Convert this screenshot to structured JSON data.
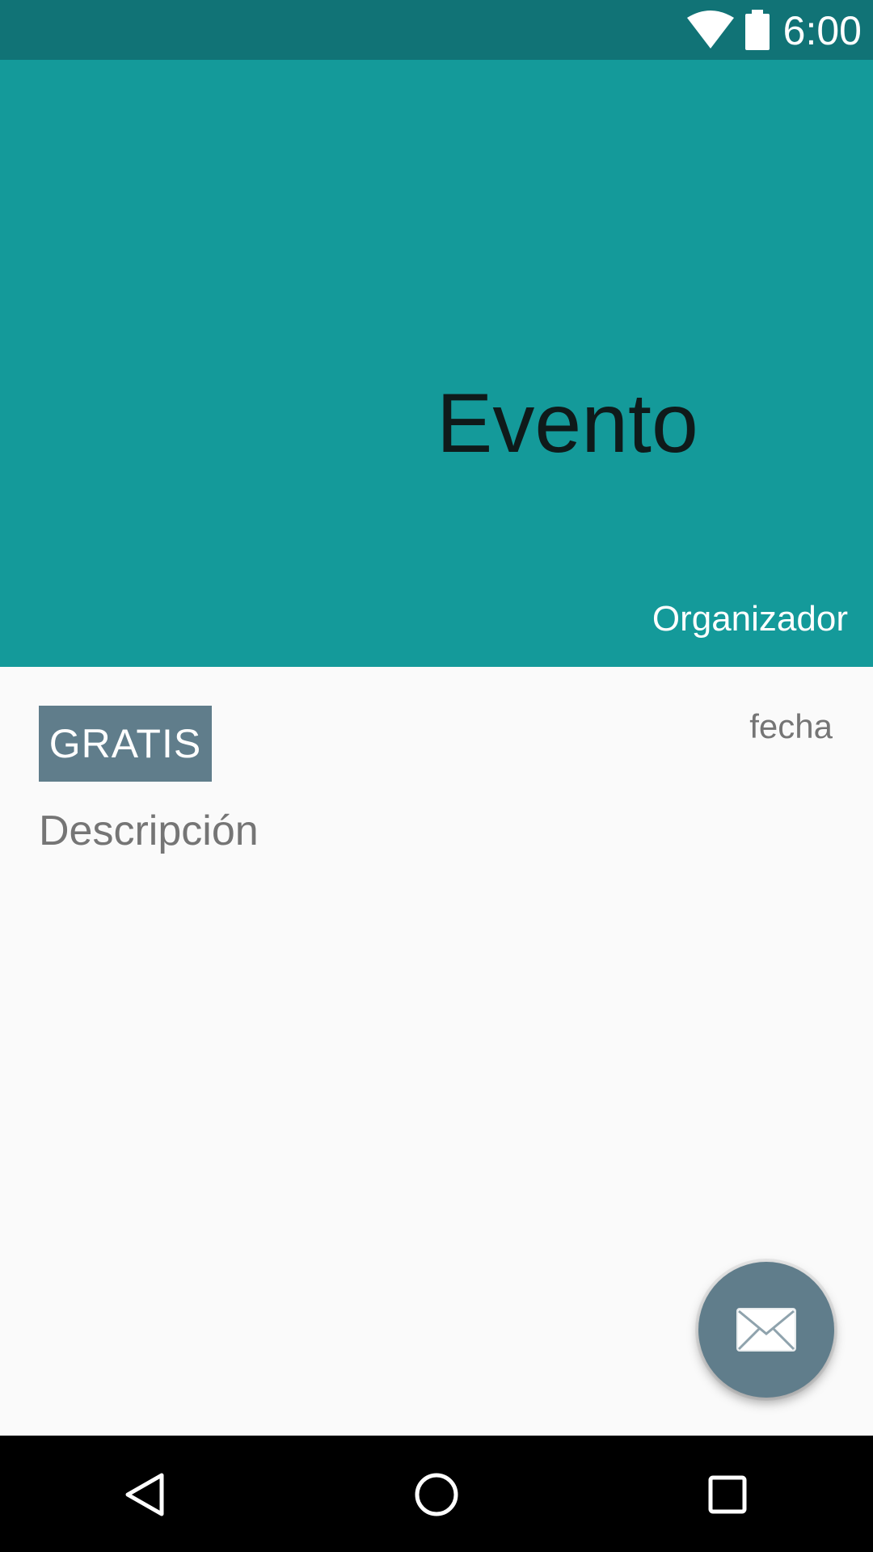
{
  "status_bar": {
    "time": "6:00",
    "icons": [
      "wifi-icon",
      "battery-icon"
    ]
  },
  "header": {
    "title": "Evento",
    "organizer": "Organizador"
  },
  "content": {
    "price_badge": "GRATIS",
    "date": "fecha",
    "description": "Descripción"
  },
  "fab": {
    "icon": "mail-icon"
  },
  "nav_bar": {
    "icons": [
      "back-icon",
      "home-icon",
      "recents-icon"
    ]
  },
  "colors": {
    "status_bar": "#117376",
    "header": "#149a9a",
    "accent": "#607d8b",
    "background": "#fafafa",
    "nav_bar": "#000000"
  }
}
